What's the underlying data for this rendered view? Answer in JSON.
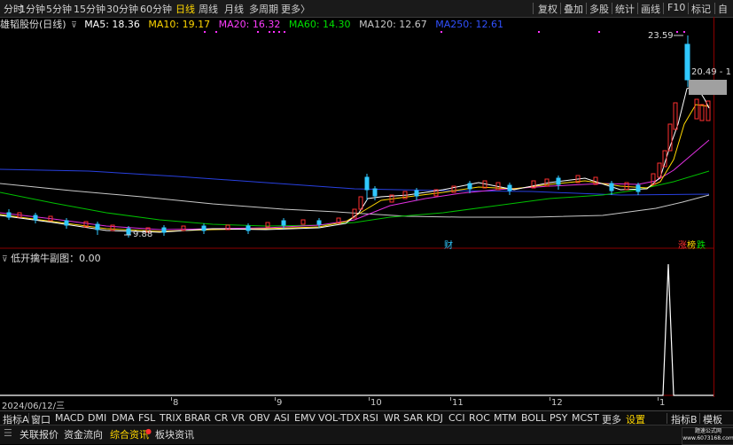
{
  "period_tabs": [
    "分时",
    "1分钟",
    "5分钟",
    "15分钟",
    "30分钟",
    "60分钟",
    "日线",
    "周线",
    "月线",
    "多周期",
    "更多〉"
  ],
  "active_period": "日线",
  "toolbar": [
    "复权",
    "叠加",
    "多股",
    "统计",
    "画线",
    "F10",
    "标记",
    "自"
  ],
  "stock_title": "雄韬股份(日线)",
  "ma_legend": [
    {
      "label": "MA5: 18.36",
      "color": "#ffffff"
    },
    {
      "label": "MA10: 19.17",
      "color": "#ffd700"
    },
    {
      "label": "MA20: 16.32",
      "color": "#ff3cff"
    },
    {
      "label": "MA60: 14.30",
      "color": "#00e000"
    },
    {
      "label": "MA120: 12.67",
      "color": "#c8c8c8"
    },
    {
      "label": "MA250: 12.61",
      "color": "#3050ff"
    }
  ],
  "price_annotations": {
    "high": "23.59",
    "low": "9.88",
    "right_label": "20.49 - 1"
  },
  "event_markers": {
    "cai": "财",
    "zhang": "涨",
    "bang": "榜",
    "die": "跌"
  },
  "sub_indicator_label": "低开擒牛副图：0.00",
  "date_axis": [
    "2024/06/12/三",
    "8",
    "9",
    "10",
    "11",
    "12",
    "1"
  ],
  "indicator_tabs": [
    "指标A",
    "窗口",
    "MACD",
    "DMI",
    "DMA",
    "FSL",
    "TRIX",
    "BRAR",
    "CR",
    "VR",
    "OBV",
    "ASI",
    "EMV",
    "VOL-TDX",
    "RSI",
    "WR",
    "SAR",
    "KDJ",
    "CCI",
    "ROC",
    "MTM",
    "BOLL",
    "PSY",
    "MCST",
    "更多",
    "设置",
    "指标B",
    "模板"
  ],
  "bottom_tabs": [
    "关联报价",
    "资金流向",
    "综合资讯",
    "板块资讯"
  ],
  "active_bottom_tab": "综合资讯",
  "watermark": [
    "题速公式网",
    "www.6073168.com"
  ],
  "colors": {
    "up": "#ff3030",
    "down": "#30c8ff",
    "axis_red": "#8b0000",
    "active": "#ffd700"
  }
}
